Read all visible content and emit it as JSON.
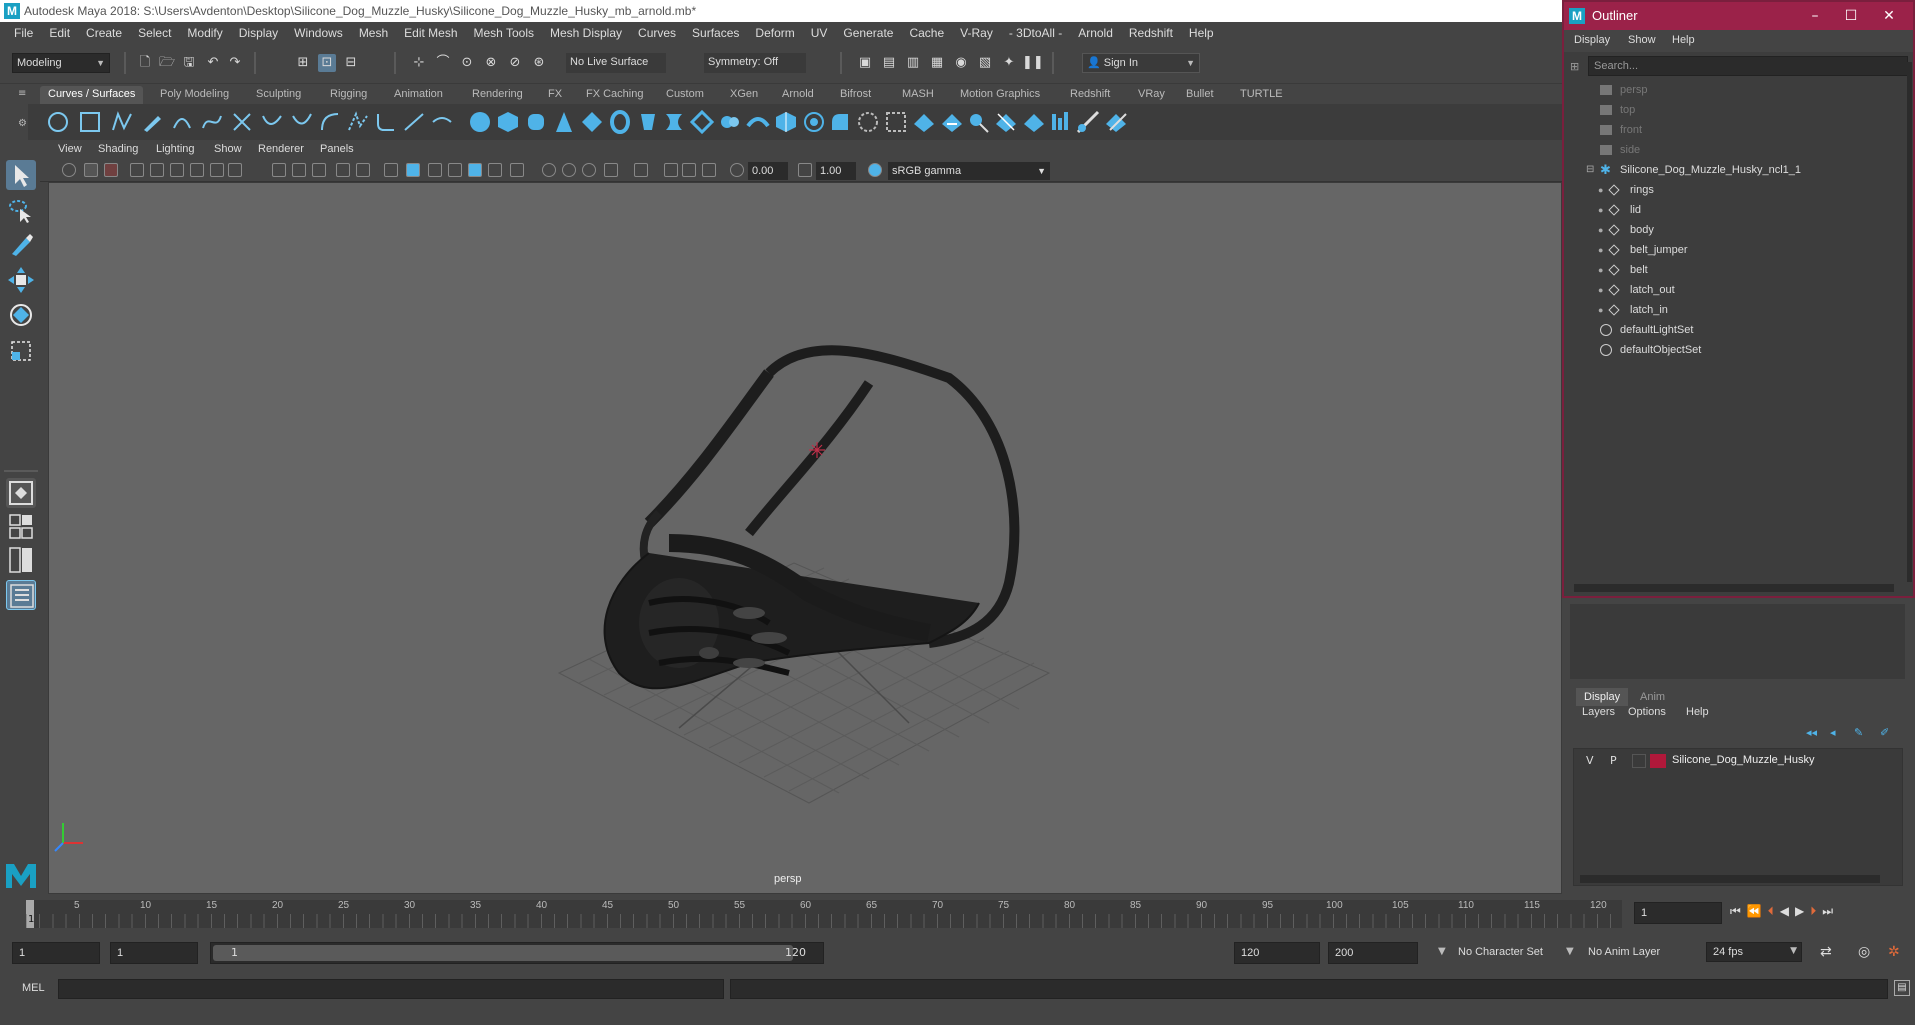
{
  "window": {
    "title": "Autodesk Maya 2018: S:\\Users\\Avdenton\\Desktop\\Silicone_Dog_Muzzle_Husky\\Silicone_Dog_Muzzle_Husky_mb_arnold.mb*"
  },
  "menubar": [
    "File",
    "Edit",
    "Create",
    "Select",
    "Modify",
    "Display",
    "Windows",
    "Mesh",
    "Edit Mesh",
    "Mesh Tools",
    "Mesh Display",
    "Curves",
    "Surfaces",
    "Deform",
    "UV",
    "Generate",
    "Cache",
    "V-Ray",
    "- 3DtoAll -",
    "Arnold",
    "Redshift",
    "Help"
  ],
  "statusline": {
    "mode": "Modeling",
    "live_surface": "No Live Surface",
    "symmetry": "Symmetry: Off",
    "sign_in": "Sign In"
  },
  "shelf_tabs": [
    "Curves / Surfaces",
    "Poly Modeling",
    "Sculpting",
    "Rigging",
    "Animation",
    "Rendering",
    "FX",
    "FX Caching",
    "Custom",
    "XGen",
    "Arnold",
    "Bifrost",
    "MASH",
    "Motion Graphics",
    "Redshift",
    "VRay",
    "Bullet",
    "TURTLE"
  ],
  "panel_menu": [
    "View",
    "Shading",
    "Lighting",
    "Show",
    "Renderer",
    "Panels"
  ],
  "panel_bar": {
    "exposure": "0.00",
    "gamma": "1.00",
    "color_space": "sRGB gamma"
  },
  "viewport": {
    "camera": "persp"
  },
  "outliner": {
    "title": "Outliner",
    "menu": [
      "Display",
      "Show",
      "Help"
    ],
    "search_placeholder": "Search...",
    "items": [
      {
        "label": "persp",
        "dim": true,
        "type": "camera"
      },
      {
        "label": "top",
        "dim": true,
        "type": "camera"
      },
      {
        "label": "front",
        "dim": true,
        "type": "camera"
      },
      {
        "label": "side",
        "dim": true,
        "type": "camera"
      },
      {
        "label": "Silicone_Dog_Muzzle_Husky_ncl1_1",
        "dim": false,
        "type": "group"
      },
      {
        "label": "rings",
        "dim": false,
        "type": "mesh"
      },
      {
        "label": "lid",
        "dim": false,
        "type": "mesh"
      },
      {
        "label": "body",
        "dim": false,
        "type": "mesh"
      },
      {
        "label": "belt_jumper",
        "dim": false,
        "type": "mesh"
      },
      {
        "label": "belt",
        "dim": false,
        "type": "mesh"
      },
      {
        "label": "latch_out",
        "dim": false,
        "type": "mesh"
      },
      {
        "label": "latch_in",
        "dim": false,
        "type": "mesh"
      },
      {
        "label": "defaultLightSet",
        "dim": false,
        "type": "set"
      },
      {
        "label": "defaultObjectSet",
        "dim": false,
        "type": "set"
      }
    ]
  },
  "layer_editor": {
    "tabs": [
      "Display",
      "Anim"
    ],
    "menu": [
      "Layers",
      "Options",
      "Help"
    ],
    "layer": {
      "v": "V",
      "p": "P",
      "name": "Silicone_Dog_Muzzle_Husky",
      "color": "#b0183a"
    }
  },
  "timeline": {
    "ticks": [
      "5",
      "10",
      "15",
      "20",
      "25",
      "30",
      "35",
      "40",
      "45",
      "50",
      "55",
      "60",
      "65",
      "70",
      "75",
      "80",
      "85",
      "90",
      "95",
      "100",
      "105",
      "110",
      "115",
      "120"
    ],
    "current_frame": "1",
    "current_field": "1"
  },
  "range": {
    "start": "1",
    "start2": "1",
    "slider_start": "1",
    "slider_end": "120",
    "end": "120",
    "end2": "200",
    "character_set": "No Character Set",
    "anim_layer": "No Anim Layer",
    "fps": "24 fps"
  },
  "cmdline": {
    "label": "MEL"
  },
  "colors": {
    "accent": "#4fb3e8",
    "outliner_header": "#9b2249",
    "layer_color": "#b0183a"
  }
}
